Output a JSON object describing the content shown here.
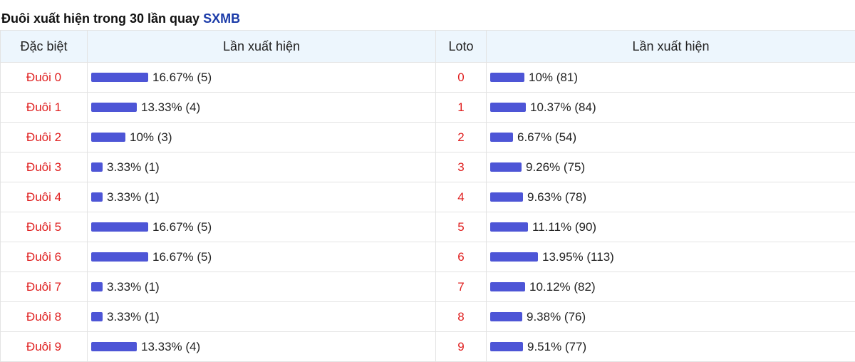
{
  "header": {
    "title_prefix": "Đuôi xuất hiện trong 30 lần quay",
    "title_brand": "SXMB"
  },
  "columns": {
    "special": "Đặc biệt",
    "occurrence_left": "Lần xuất hiện",
    "loto": "Loto",
    "occurrence_right": "Lần xuất hiện"
  },
  "colors": {
    "bar": "#4d55d6",
    "label": "#e02020",
    "brand": "#1a3aa8",
    "header_bg": "#edf6fd"
  },
  "rows": [
    {
      "special_label": "Đuôi 0",
      "special_text": "16.67% (5)",
      "special_pct": 16.67,
      "loto_label": "0",
      "loto_text": "10% (81)",
      "loto_pct": 10
    },
    {
      "special_label": "Đuôi 1",
      "special_text": "13.33% (4)",
      "special_pct": 13.33,
      "loto_label": "1",
      "loto_text": "10.37% (84)",
      "loto_pct": 10.37
    },
    {
      "special_label": "Đuôi 2",
      "special_text": "10% (3)",
      "special_pct": 10,
      "loto_label": "2",
      "loto_text": "6.67% (54)",
      "loto_pct": 6.67
    },
    {
      "special_label": "Đuôi 3",
      "special_text": "3.33% (1)",
      "special_pct": 3.33,
      "loto_label": "3",
      "loto_text": "9.26% (75)",
      "loto_pct": 9.26
    },
    {
      "special_label": "Đuôi 4",
      "special_text": "3.33% (1)",
      "special_pct": 3.33,
      "loto_label": "4",
      "loto_text": "9.63% (78)",
      "loto_pct": 9.63
    },
    {
      "special_label": "Đuôi 5",
      "special_text": "16.67% (5)",
      "special_pct": 16.67,
      "loto_label": "5",
      "loto_text": "11.11% (90)",
      "loto_pct": 11.11
    },
    {
      "special_label": "Đuôi 6",
      "special_text": "16.67% (5)",
      "special_pct": 16.67,
      "loto_label": "6",
      "loto_text": "13.95% (113)",
      "loto_pct": 13.95
    },
    {
      "special_label": "Đuôi 7",
      "special_text": "3.33% (1)",
      "special_pct": 3.33,
      "loto_label": "7",
      "loto_text": "10.12% (82)",
      "loto_pct": 10.12
    },
    {
      "special_label": "Đuôi 8",
      "special_text": "3.33% (1)",
      "special_pct": 3.33,
      "loto_label": "8",
      "loto_text": "9.38% (76)",
      "loto_pct": 9.38
    },
    {
      "special_label": "Đuôi 9",
      "special_text": "13.33% (4)",
      "special_pct": 13.33,
      "loto_label": "9",
      "loto_text": "9.51% (77)",
      "loto_pct": 9.51
    }
  ]
}
